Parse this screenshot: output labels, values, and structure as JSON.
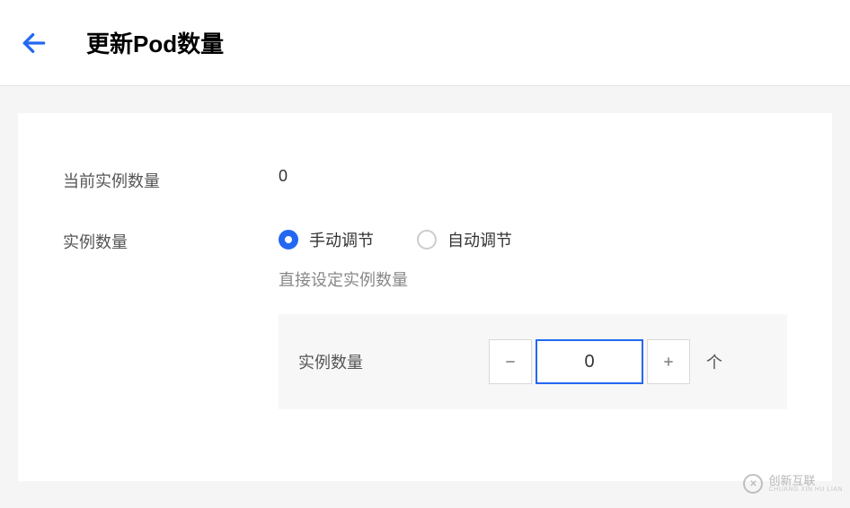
{
  "header": {
    "title": "更新Pod数量"
  },
  "form": {
    "currentCount": {
      "label": "当前实例数量",
      "value": "0"
    },
    "instanceCount": {
      "label": "实例数量",
      "radios": {
        "manual": "手动调节",
        "auto": "自动调节"
      },
      "helper": "直接设定实例数量",
      "stepper": {
        "label": "实例数量",
        "value": "0",
        "unit": "个"
      }
    }
  },
  "watermark": {
    "text": "创新互联",
    "sub": "CHUANG XIN HU LIAN"
  }
}
